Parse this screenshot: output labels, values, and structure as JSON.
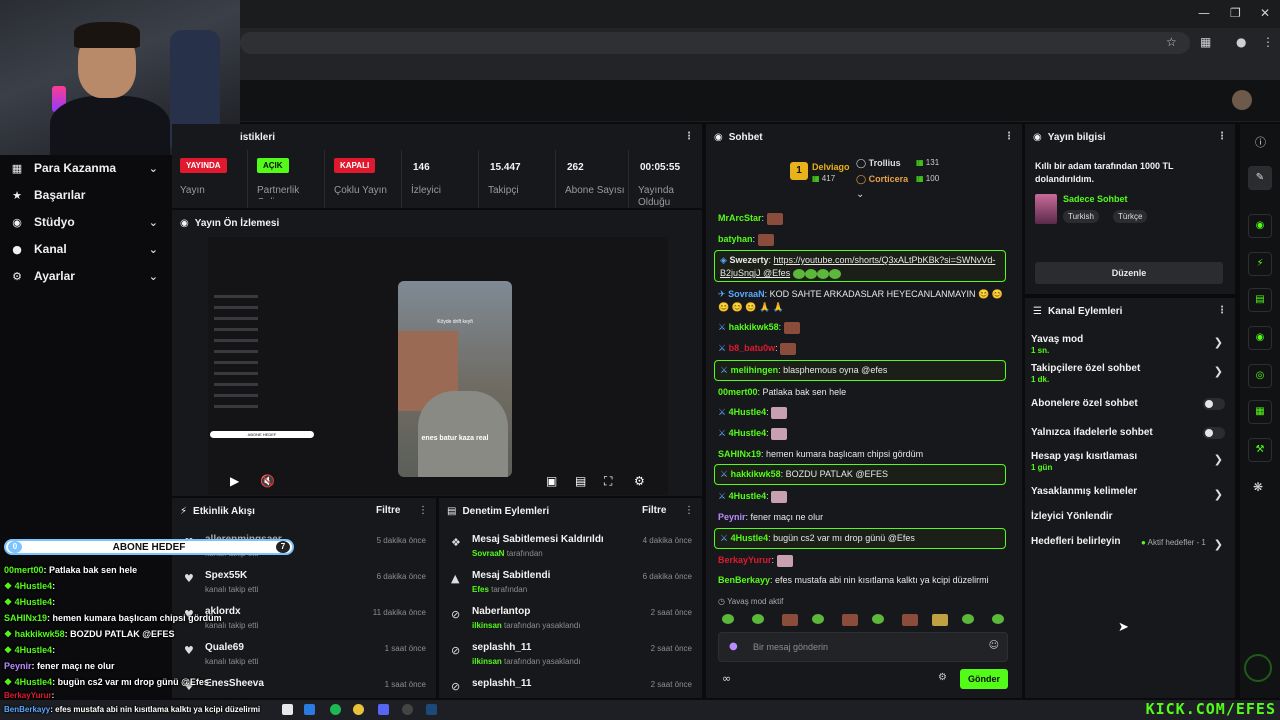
{
  "sidebar": {
    "items": [
      {
        "label": "Para Kazanma",
        "icon": "money-icon",
        "expandable": true
      },
      {
        "label": "Başarılar",
        "icon": "trophy-icon",
        "expandable": false
      },
      {
        "label": "Stüdyo",
        "icon": "camera-icon",
        "expandable": true
      },
      {
        "label": "Kanal",
        "icon": "person-icon",
        "expandable": true
      },
      {
        "label": "Ayarlar",
        "icon": "gear-icon",
        "expandable": true
      }
    ]
  },
  "stats": {
    "title": "istikleri",
    "items": [
      {
        "badge": "YAYINDA",
        "badge_color": "#e0192f",
        "label": "Yayın"
      },
      {
        "badge": "AÇIK",
        "badge_color": "#53fc18",
        "label": "Partnerlik Geli..."
      },
      {
        "badge": "KAPALI",
        "badge_color": "#e0192f",
        "label": "Çoklu Yayın"
      },
      {
        "value": "146",
        "label": "İzleyici"
      },
      {
        "value": "15.447",
        "label": "Takipçi"
      },
      {
        "value": "262",
        "label": "Abone Sayısı"
      },
      {
        "value": "00:05:55",
        "label": "Yayında Olduğu"
      }
    ]
  },
  "preview": {
    "title": "Yayın Ön İzlemesi",
    "caption_top": "Köyde drift keyfi",
    "caption_bottom": "enes batur kaza real",
    "mini_goal": "ABONE HEDEF"
  },
  "activity": {
    "title": "Etkinlik Akışı",
    "filter": "Filtre",
    "rows": [
      {
        "name": "allerenmingsaer",
        "sub": "kanalı takip etti",
        "time": "5 dakika önce"
      },
      {
        "name": "Spex55K",
        "sub": "kanalı takip etti",
        "time": "6 dakika önce"
      },
      {
        "name": "aklordx",
        "sub": "kanalı takip etti",
        "time": "11 dakika önce"
      },
      {
        "name": "Quale69",
        "sub": "kanalı takip etti",
        "time": "1 saat önce"
      },
      {
        "name": "EnesSheeva",
        "sub": "",
        "time": "1 saat önce"
      }
    ]
  },
  "moderation": {
    "title": "Denetim Eylemleri",
    "filter": "Filtre",
    "rows": [
      {
        "title": "Mesaj Sabitlemesi Kaldırıldı",
        "actor": "SovraaN",
        "sub": " tarafından",
        "time": "4 dakika önce",
        "icon": "unpin-icon"
      },
      {
        "title": "Mesaj Sabitlendi",
        "actor": "Efes",
        "sub": " tarafından",
        "time": "6 dakika önce",
        "icon": "pin-icon"
      },
      {
        "title": "Naberlantop",
        "actor": "ilkinsan",
        "sub": " tarafından yasaklandı",
        "time": "2 saat önce",
        "icon": "ban-icon"
      },
      {
        "title": "seplashh_11",
        "actor": "ilkinsan",
        "sub": " tarafından yasaklandı",
        "time": "2 saat önce",
        "icon": "ban-icon"
      },
      {
        "title": "seplashh_11",
        "actor": "",
        "sub": "",
        "time": "2 saat önce",
        "icon": "ban-icon"
      }
    ]
  },
  "chat": {
    "title": "Sohbet",
    "top_gifters": [
      {
        "rank": "1",
        "name": "Delviago",
        "amount": "417"
      },
      {
        "rank": "2",
        "name": "Trollius",
        "amount": "131"
      },
      {
        "rank": "3",
        "name": "Corticera",
        "amount": "100"
      }
    ],
    "messages": [
      {
        "user": "MrArcStar",
        "text": "",
        "color": "#53fc18",
        "emote": true
      },
      {
        "user": "batyhan",
        "text": "",
        "color": "#53fc18",
        "emote": true
      },
      {
        "user": "Swezerty",
        "text": "https://youtube.com/shorts/Q3xALtPbKBk?si=SWNvVd-B2juSnqjJ @Efes",
        "color": "#5aa8ff",
        "hl": true
      },
      {
        "user": "SovraaN",
        "text": "KOD SAHTE ARKADASLAR HEYECANLANMAYIN 😊 😊 😊 😊 😊 🙏 🙏",
        "color": "#5aa8ff"
      },
      {
        "user": "hakkikwk58",
        "text": "",
        "color": "#53fc18",
        "emote": true
      },
      {
        "user": "b8_batu0w",
        "text": "",
        "color": "#e0192f",
        "emote": true
      },
      {
        "user": "melihingen",
        "text": "blasphemous oyna @efes",
        "color": "#53fc18",
        "hl": true
      },
      {
        "user": "00mert00",
        "text": "Patlaka bak sen hele",
        "color": "#53fc18"
      },
      {
        "user": "4Hustle4",
        "text": "",
        "color": "#53fc18",
        "emote": true
      },
      {
        "user": "4Hustle4",
        "text": "",
        "color": "#53fc18",
        "emote": true
      },
      {
        "user": "SAHINx19",
        "text": "hemen kumara başlıcam chipsi gördüm",
        "color": "#53fc18"
      },
      {
        "user": "hakkikwk58",
        "text": "BOZDU PATLAK @EFES",
        "color": "#53fc18",
        "hl": true
      },
      {
        "user": "4Hustle4",
        "text": "",
        "color": "#53fc18",
        "emote": true
      },
      {
        "user": "Peynir",
        "text": "fener maçı ne olur",
        "color": "#b98bff"
      },
      {
        "user": "4Hustle4",
        "text": "bugün cs2 var mı drop günü @Efes",
        "color": "#53fc18",
        "hl": true
      },
      {
        "user": "BerkayYurur",
        "text": "",
        "color": "#e0192f",
        "emote": true
      },
      {
        "user": "BenBerkayy",
        "text": "efes mustafa abi nin kısıtlama kalktı ya kcipi düzelirmi",
        "color": "#53fc18"
      }
    ],
    "slow_mode_note": "Yavaş mod aktif",
    "input_placeholder": "Bir mesaj gönderin",
    "send_label": "Gönder"
  },
  "stream_info": {
    "title": "Yayın bilgisi",
    "stream_title": "Kıllı bir adam tarafından 1000 TL dolandırıldım.",
    "category": "Sadece Sohbet",
    "tags": [
      "Turkish",
      "Türkçe"
    ],
    "edit_label": "Düzenle"
  },
  "channel_actions": {
    "title": "Kanal Eylemleri",
    "rows": [
      {
        "label": "Yavaş mod",
        "sub": "1 sn.",
        "type": "chevron"
      },
      {
        "label": "Takipçilere özel sohbet",
        "sub": "1 dk.",
        "type": "chevron"
      },
      {
        "label": "Abonelere özel sohbet",
        "sub": "",
        "type": "toggle"
      },
      {
        "label": "Yalnızca ifadelerle sohbet",
        "sub": "",
        "type": "toggle"
      },
      {
        "label": "Hesap yaşı kısıtlaması",
        "sub": "1 gün",
        "type": "chevron"
      },
      {
        "label": "Yasaklanmış kelimeler",
        "sub": "",
        "type": "chevron"
      },
      {
        "label": "İzleyici Yönlendir",
        "sub": "",
        "type": "none"
      },
      {
        "label": "Hedefleri belirleyin",
        "sub": "",
        "type": "chevron",
        "note": "Aktif hedefler - 1"
      }
    ]
  },
  "overlay_chat": {
    "goal_start": "0",
    "goal_label": "ABONE HEDEF",
    "goal_end": "7",
    "lines": [
      {
        "user": "00mert00",
        "text": ": Patlaka bak sen hele"
      },
      {
        "user": "4Hustle4",
        "text": ":"
      },
      {
        "user": "4Hustle4",
        "text": ":"
      },
      {
        "user": "SAHINx19",
        "text": ": hemen kumara başlıcam chipsi gördüm"
      },
      {
        "user": "hakkikwk58",
        "text": ": BOZDU PATLAK @EFES"
      },
      {
        "user": "4Hustle4",
        "text": ":"
      },
      {
        "user": "Peynir",
        "text": ": fener maçı ne olur"
      },
      {
        "user": "4Hustle4",
        "text": ": bugün cs2 var mı drop günü @Efes"
      },
      {
        "user": "BerkayYurur",
        "text": ":"
      },
      {
        "user": "BenBerkayy",
        "text": ": efes mustafa abi nin kısıtlama kalktı ya kcipi düzelirmi"
      }
    ]
  },
  "watermark": "KICK.COM/EFES",
  "colors": {
    "accent": "#53fc18",
    "live": "#e0192f",
    "panel": "#17181b"
  }
}
